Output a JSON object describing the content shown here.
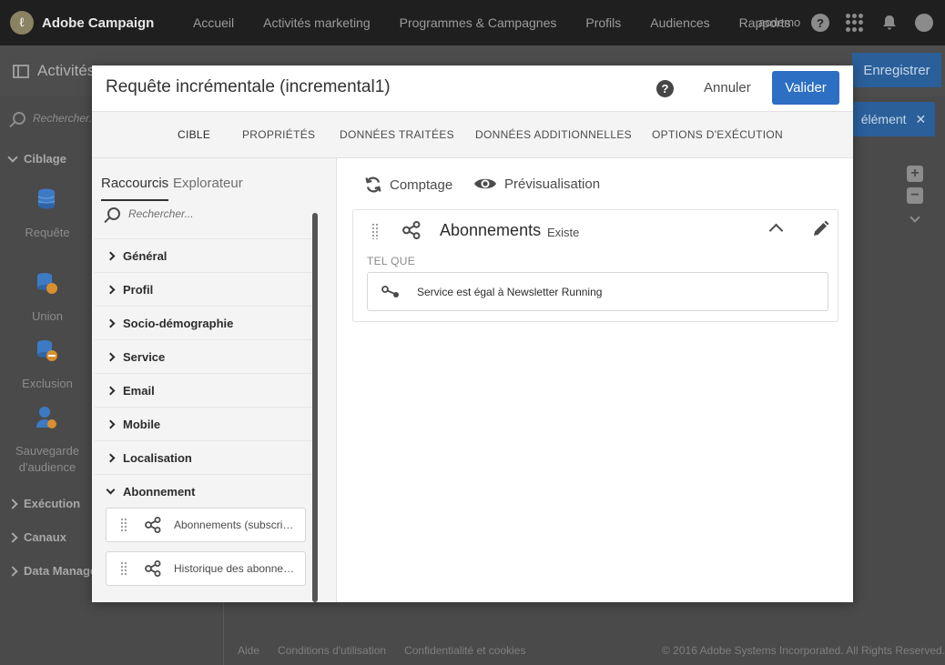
{
  "app": {
    "brand": "Adobe Campaign",
    "nav": [
      "Accueil",
      "Activités marketing",
      "Programmes & Campagnes",
      "Profils",
      "Audiences",
      "Rapports"
    ],
    "user": "acdemo",
    "help_glyph": "?"
  },
  "workflow": {
    "title": "Activités",
    "save_label": "Enregistrer",
    "chip_label": "élément",
    "chip_close": "✕"
  },
  "palette": {
    "search_placeholder": "Rechercher...",
    "groups": {
      "targeting": "Ciblage",
      "execution": "Exécution",
      "channels": "Canaux",
      "data": "Data Manage"
    },
    "activities": [
      {
        "label": "Requête",
        "icon": "query-icon"
      },
      {
        "label": "Union",
        "icon": "union-icon"
      },
      {
        "label": "Exclusion",
        "icon": "exclusion-icon"
      },
      {
        "label": "Sauvegarde d'audience",
        "icon": "save-audience-icon"
      }
    ]
  },
  "modal": {
    "title": "Requête incrémentale (incremental1)",
    "help_glyph": "?",
    "cancel_label": "Annuler",
    "validate_label": "Valider",
    "tabs": [
      "CIBLE",
      "PROPRIÉTÉS",
      "DONNÉES TRAITÉES",
      "DONNÉES ADDITIONNELLES",
      "OPTIONS D'EXÉCUTION"
    ],
    "active_tab": "CIBLE",
    "left": {
      "subtabs": [
        "Raccourcis",
        "Explorateur"
      ],
      "search_placeholder": "Rechercher...",
      "categories": [
        "Général",
        "Profil",
        "Socio-démographie",
        "Service",
        "Email",
        "Mobile",
        "Localisation",
        "Abonnement"
      ],
      "expanded_category": "Abonnement",
      "items": [
        "Abonnements (subscriptions)",
        "Historique des abonnements"
      ]
    },
    "right": {
      "count_label": "Comptage",
      "preview_label": "Prévisualisation",
      "block": {
        "title": "Abonnements",
        "operator": "Existe",
        "section_label": "TEL QUE",
        "condition": "Service est égal à Newsletter Running"
      }
    }
  },
  "footer": {
    "links": [
      "Aide",
      "Conditions d'utilisation",
      "Confidentialité et cookies"
    ],
    "copyright": "© 2016 Adobe Systems Incorporated. All Rights Reserved."
  }
}
